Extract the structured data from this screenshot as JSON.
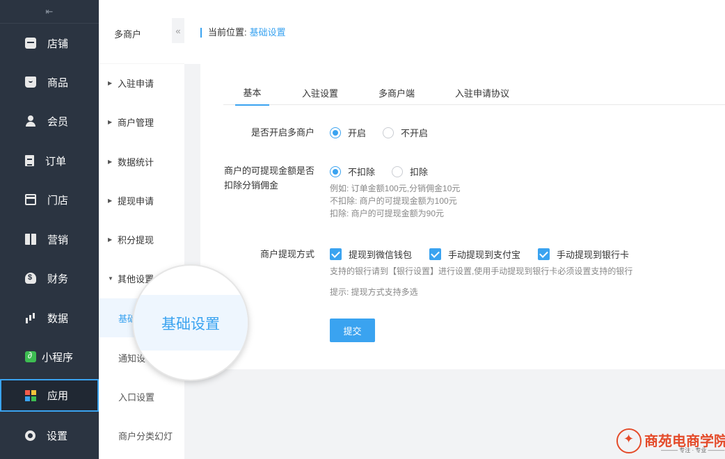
{
  "sidebar": {
    "collapse_icon": "⇤",
    "items": [
      {
        "label": "店铺",
        "icon": "shop-icon"
      },
      {
        "label": "商品",
        "icon": "goods-icon"
      },
      {
        "label": "会员",
        "icon": "user-icon"
      },
      {
        "label": "订单",
        "icon": "order-icon"
      },
      {
        "label": "门店",
        "icon": "store-icon"
      },
      {
        "label": "营销",
        "icon": "gift-icon"
      },
      {
        "label": "财务",
        "icon": "money-bag-icon"
      },
      {
        "label": "数据",
        "icon": "bar-chart-icon"
      },
      {
        "label": "小程序",
        "icon": "mini-program-icon"
      },
      {
        "label": "应用",
        "icon": "apps-icon",
        "active": true
      },
      {
        "label": "设置",
        "icon": "gear-icon"
      }
    ],
    "active_border_color": "#3aa3f0"
  },
  "submenu": {
    "title": "多商户",
    "collapse_glyph": "«",
    "groups": [
      {
        "label": "入驻申请"
      },
      {
        "label": "商户管理"
      },
      {
        "label": "数据统计"
      },
      {
        "label": "提现申请"
      },
      {
        "label": "积分提现"
      },
      {
        "label": "其他设置",
        "expanded": true
      }
    ],
    "children": [
      {
        "label": "基础设置",
        "active": true
      },
      {
        "label": "通知设置"
      },
      {
        "label": "入口设置"
      },
      {
        "label": "商户分类幻灯"
      }
    ],
    "visible_text": {
      "other_settings": "其他设置",
      "basic_settings_cut": "基础",
      "notify_settings_cut": "通知设"
    }
  },
  "breadcrumb": {
    "prefix": "当前位置:",
    "current": "基础设置"
  },
  "tabs": [
    {
      "label": "基本",
      "active": true
    },
    {
      "label": "入驻设置"
    },
    {
      "label": "多商户端"
    },
    {
      "label": "入驻申请协议"
    }
  ],
  "form": {
    "enable_multi_merchant": {
      "label": "是否开启多商户",
      "options": [
        {
          "label": "开启",
          "selected": true
        },
        {
          "label": "不开启",
          "selected": false
        }
      ]
    },
    "deduct_commission": {
      "label_line1": "商户的可提现金额是否",
      "label_line2": "扣除分销佣金",
      "options": [
        {
          "label": "不扣除",
          "selected": true
        },
        {
          "label": "扣除",
          "selected": false
        }
      ],
      "hints": [
        "例如: 订单金额100元,分销佣金10元",
        "不扣除: 商户的可提现金额为100元",
        "扣除: 商户的可提现金额为90元"
      ]
    },
    "withdraw_methods": {
      "label": "商户提现方式",
      "options": [
        {
          "label": "提现到微信钱包",
          "checked": true
        },
        {
          "label": "手动提现到支付宝",
          "checked": true
        },
        {
          "label": "手动提现到银行卡",
          "checked": true
        }
      ],
      "hint": "支持的银行请到【银行设置】进行设置,使用手动提现到银行卡必须设置支持的银行",
      "tip": "提示: 提现方式支持多选"
    },
    "submit_label": "提交"
  },
  "magnifier": {
    "text": "基础设置"
  },
  "watermark": {
    "name": "商苑电商学院",
    "slogan": "——— 专注 · 专业 ———"
  },
  "colors": {
    "accent": "#3aa3f0",
    "sidebar_bg": "#2b3441",
    "watermark": "#e44b2a"
  }
}
